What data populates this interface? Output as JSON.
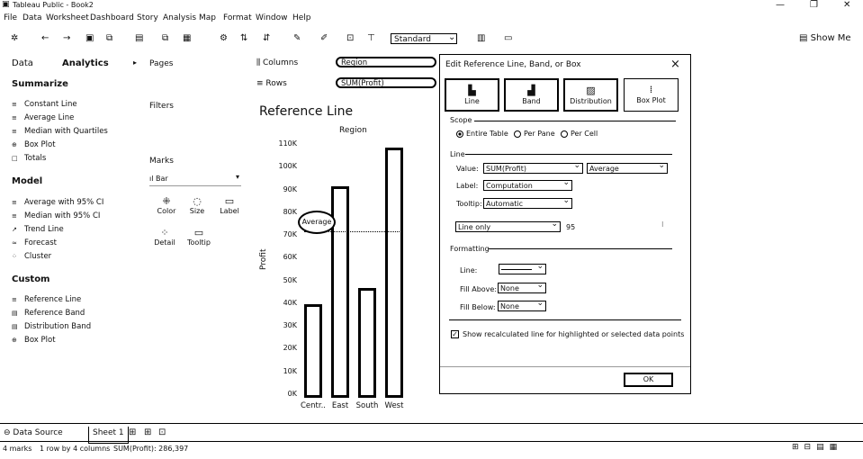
{
  "window": {
    "title": "Tableau Public - Book2"
  },
  "menu": [
    "File",
    "Data",
    "Worksheet",
    "Dashboard",
    "Story",
    "Analysis",
    "Map",
    "Format",
    "Window",
    "Help"
  ],
  "toolbar": {
    "marks_type_value": "Standard",
    "show_me_label": "Show Me"
  },
  "left_pane": {
    "tabs": [
      "Data",
      "Analytics"
    ],
    "summarize": {
      "heading": "Summarize",
      "items": [
        "Constant Line",
        "Average Line",
        "Median with Quartiles",
        "Box Plot",
        "Totals"
      ]
    },
    "model": {
      "heading": "Model",
      "items": [
        "Average with 95% CI",
        "Median with 95% CI",
        "Trend Line",
        "Forecast",
        "Cluster"
      ]
    },
    "custom": {
      "heading": "Custom",
      "items": [
        "Reference Line",
        "Reference Band",
        "Distribution Band",
        "Box Plot"
      ]
    }
  },
  "cards": {
    "pages": "Pages",
    "filters": "Filters",
    "marks": "Marks",
    "mark_type": "Bar",
    "mark_buttons": [
      "Color",
      "Size",
      "Label",
      "Detail",
      "Tooltip"
    ]
  },
  "shelves": {
    "columns_label": "Columns",
    "columns_pill": "Region",
    "rows_label": "Rows",
    "rows_pill": "SUM(Profit)"
  },
  "chart_data": {
    "type": "bar",
    "title": "Reference Line",
    "column_header": "Region",
    "xlabel": "",
    "ylabel": "Profit",
    "categories": [
      "Centr..",
      "East",
      "South",
      "West"
    ],
    "values": [
      39700,
      91500,
      46700,
      108400
    ],
    "ylim": [
      0,
      110000
    ],
    "yticks": [
      "0K",
      "10K",
      "20K",
      "30K",
      "40K",
      "50K",
      "60K",
      "70K",
      "80K",
      "90K",
      "100K",
      "110K"
    ],
    "reference_line": {
      "label": "Average",
      "value": 71600
    }
  },
  "dialog": {
    "title": "Edit Reference Line, Band, or Box",
    "close_icon": "×",
    "types": [
      "Line",
      "Band",
      "Distribution",
      "Box Plot"
    ],
    "scope": {
      "heading": "Scope",
      "options": [
        "Entire Table",
        "Per Pane",
        "Per Cell"
      ],
      "selected": "Entire Table"
    },
    "line": {
      "heading": "Line",
      "value_label": "Value:",
      "value_field": "SUM(Profit)",
      "value_agg": "Average",
      "label_label": "Label:",
      "label_value": "Computation",
      "tooltip_label": "Tooltip:",
      "tooltip_value": "Automatic",
      "display": "Line only",
      "confidence": "95"
    },
    "formatting": {
      "heading": "Formatting",
      "line_label": "Line:",
      "fill_above_label": "Fill Above:",
      "fill_above_value": "None",
      "fill_below_label": "Fill Below:",
      "fill_below_value": "None"
    },
    "checkbox_label": "Show recalculated line for highlighted or selected data points",
    "ok_label": "OK"
  },
  "bottom": {
    "tabs": [
      "Data Source",
      "Sheet 1"
    ],
    "status": [
      "4 marks",
      "1 row by 4 columns",
      "SUM(Profit): 286,397"
    ]
  }
}
